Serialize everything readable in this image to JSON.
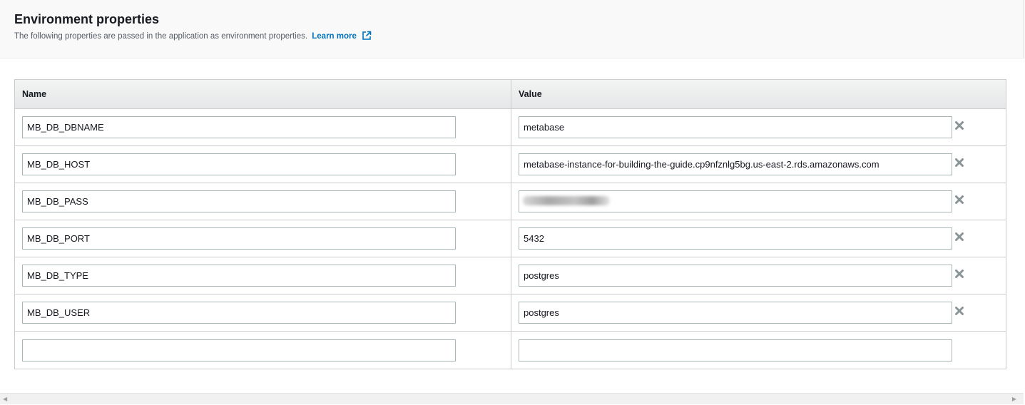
{
  "section": {
    "title": "Environment properties",
    "description": "The following properties are passed in the application as environment properties.",
    "learn_more": "Learn more"
  },
  "table": {
    "headers": {
      "name": "Name",
      "value": "Value"
    },
    "rows": [
      {
        "name": "MB_DB_DBNAME",
        "value": "metabase",
        "masked": false
      },
      {
        "name": "MB_DB_HOST",
        "value": "metabase-instance-for-building-the-guide.cp9nfznlg5bg.us-east-2.rds.amazonaws.com",
        "masked": false
      },
      {
        "name": "MB_DB_PASS",
        "value": "",
        "masked": true
      },
      {
        "name": "MB_DB_PORT",
        "value": "5432",
        "masked": false
      },
      {
        "name": "MB_DB_TYPE",
        "value": "postgres",
        "masked": false
      },
      {
        "name": "MB_DB_USER",
        "value": "postgres",
        "masked": false
      }
    ],
    "empty_row": {
      "name": "",
      "value": ""
    }
  },
  "icons": {
    "remove": "remove-icon",
    "external_link": "external-link-icon"
  },
  "colors": {
    "link": "#0073bb",
    "remove_icon": "#879596"
  }
}
